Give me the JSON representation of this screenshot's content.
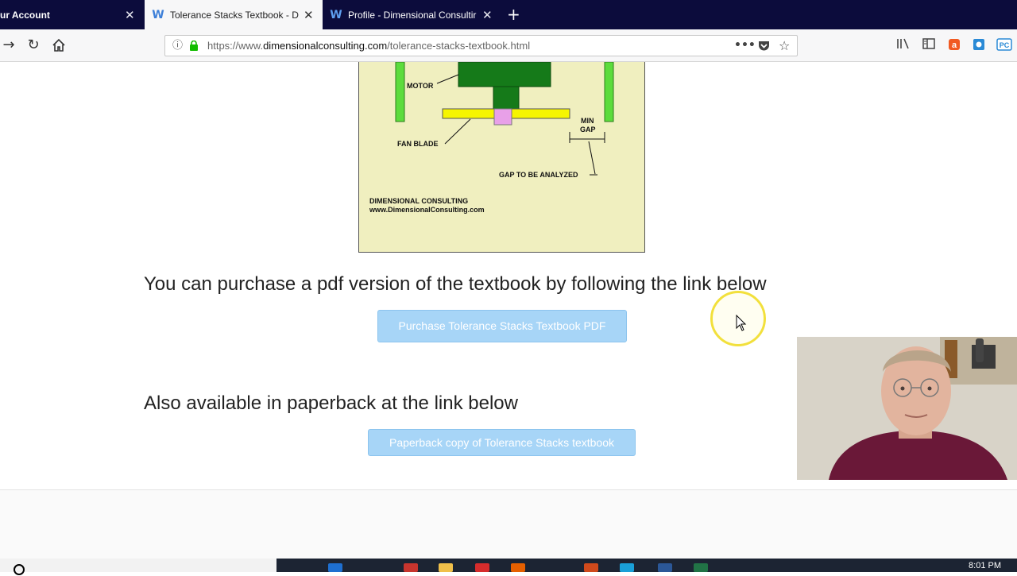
{
  "browser": {
    "tabs": [
      {
        "title": "ur Account",
        "active": false
      },
      {
        "title": "Tolerance Stacks Textbook - Di",
        "active": true
      },
      {
        "title": "Profile - Dimensional Consultir",
        "active": false
      }
    ],
    "url_prefix": "https://www.",
    "url_host": "dimensionalconsulting.com",
    "url_path": "/tolerance-stacks-textbook.html",
    "icons": [
      "back-icon",
      "reload-icon",
      "home-icon",
      "info-icon",
      "lock-icon",
      "more-icon",
      "pocket-icon",
      "bookmark-star-icon",
      "library-icon",
      "sidebar-icon"
    ]
  },
  "figure": {
    "motor_label": "MOTOR",
    "fan_blade_label": "FAN BLADE",
    "min_gap_label_1": "MIN",
    "min_gap_label_2": "GAP",
    "gap_label": "GAP  TO BE ANALYZED",
    "company": "DIMENSIONAL CONSULTING",
    "website": "www.DimensionalConsulting.com"
  },
  "content": {
    "pdf_heading": "You can purchase a pdf version of the textbook by following the link below",
    "pdf_button": "Purchase Tolerance Stacks Textbook PDF",
    "paperback_heading": "Also available in paperback at the link below",
    "paperback_button": "Paperback copy of Tolerance Stacks textbook"
  },
  "taskbar": {
    "clock": "8:01 PM"
  },
  "colors": {
    "tab_strip": "#0c0c3c",
    "button_bg": "#a7d5f7",
    "figure_bg": "#f0efbf",
    "motor_green": "#157a19",
    "wall_green": "#5cdc3c",
    "fan_yellow": "#f6f500"
  }
}
